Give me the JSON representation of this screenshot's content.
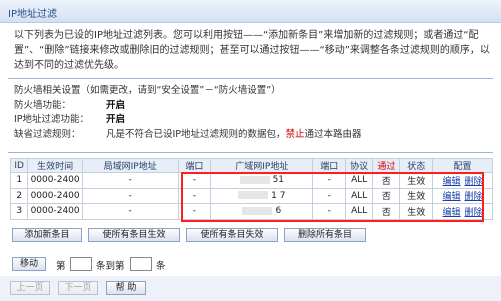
{
  "window": {
    "title": "IP地址过滤"
  },
  "description": {
    "text": "以下列表为已设的IP地址过滤列表。您可以利用按钮——“添加新条目”来增加新的过滤规则；或者通过“配置”、“删除”链接来修改或删除旧的过滤规则；甚至可以通过按钮——“移动”来调整各条过滤规则的顺序，以达到不同的过滤优先级。"
  },
  "info": {
    "firewall_line": "防火墙相关设置（如需更改，请到“安全设置”－“防火墙设置”）",
    "firewall_label": "防火墙功能：",
    "firewall_value": "开启",
    "ipfilter_label": "IP地址过滤功能：",
    "ipfilter_value": "开启",
    "default_label": "缺省过滤规则：",
    "default_pre": "凡是不符合已设IP地址过滤规则的数据包，",
    "default_red": "禁止",
    "default_post": "通过本路由器"
  },
  "table": {
    "headers": {
      "id": "ID",
      "time": "生效时间",
      "lan_ip": "局域网IP地址",
      "port1": "端口",
      "wan_ip": "广域网IP地址",
      "port2": "端口",
      "protocol": "协议",
      "pass": "通过",
      "status": "状态",
      "config": "配置"
    },
    "rows": [
      {
        "id": "1",
        "time": "0000-2400",
        "lan_ip": "-",
        "port1": "-",
        "wan_ip": "51",
        "port2": "-",
        "protocol": "ALL",
        "pass": "否",
        "status": "生效",
        "edit": "编辑",
        "del": "删除"
      },
      {
        "id": "2",
        "time": "0000-2400",
        "lan_ip": "-",
        "port1": "-",
        "wan_ip": "1 7",
        "port2": "-",
        "protocol": "ALL",
        "pass": "否",
        "status": "生效",
        "edit": "编辑",
        "del": "删除"
      },
      {
        "id": "3",
        "time": "0000-2400",
        "lan_ip": "-",
        "port1": "-",
        "wan_ip": "6",
        "port2": "-",
        "protocol": "ALL",
        "pass": "否",
        "status": "生效",
        "edit": "编辑",
        "del": "删除"
      }
    ]
  },
  "buttons": {
    "add": "添加新条目",
    "enable_all": "使所有条目生效",
    "disable_all": "使所有条目失效",
    "delete_all": "删除所有条目",
    "move": "移动",
    "move_label_1": "第",
    "move_label_2": "条到第",
    "move_label_3": "条",
    "prev": "上一页",
    "next": "下一页",
    "help": "帮 助"
  }
}
